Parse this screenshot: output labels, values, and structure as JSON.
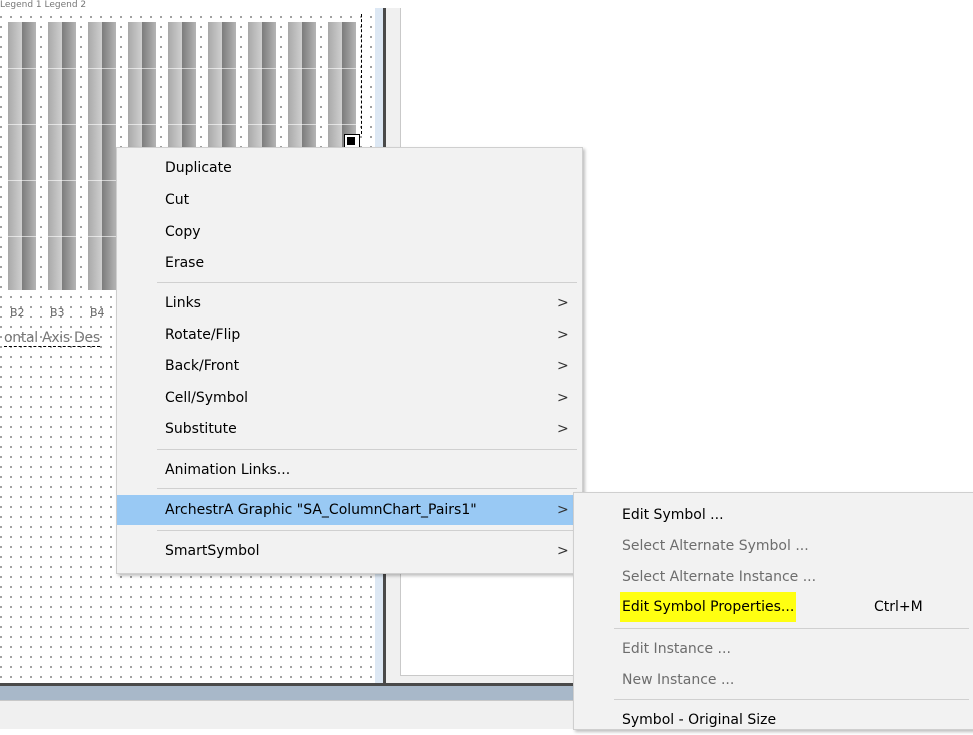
{
  "chart": {
    "legend": "Legend 1  Legend 2",
    "x_labels": [
      "B2",
      "B3",
      "B4"
    ],
    "axis_description": "ontal Axis Des"
  },
  "chart_data": {
    "type": "bar",
    "categories": [
      "B2",
      "B3",
      "B4"
    ],
    "xlabel": "ontal Axis Des"
  },
  "context_menu": {
    "items": [
      {
        "label": "Duplicate"
      },
      {
        "label": "Cut"
      },
      {
        "label": "Copy"
      },
      {
        "label": "Erase"
      },
      {
        "label": "Links",
        "submenu": true
      },
      {
        "label": "Rotate/Flip",
        "submenu": true
      },
      {
        "label": "Back/Front",
        "submenu": true
      },
      {
        "label": "Cell/Symbol",
        "submenu": true
      },
      {
        "label": "Substitute",
        "submenu": true
      },
      {
        "label": "Animation Links..."
      },
      {
        "label": "ArchestrA Graphic \"SA_ColumnChart_Pairs1\"",
        "submenu": true,
        "highlighted": true
      },
      {
        "label": "SmartSymbol",
        "submenu": true
      }
    ],
    "arrow_glyph": ">"
  },
  "submenu": {
    "items": [
      {
        "label": "Edit Symbol ...",
        "enabled": true
      },
      {
        "label": "Select Alternate Symbol ...",
        "enabled": false
      },
      {
        "label": "Select Alternate Instance ...",
        "enabled": false
      },
      {
        "label": "Edit Symbol Properties...",
        "enabled": true,
        "highlighted": true,
        "shortcut": "Ctrl+M"
      },
      {
        "label": "Edit Instance ...",
        "enabled": false
      },
      {
        "label": "New Instance ...",
        "enabled": false
      },
      {
        "label": "Symbol - Original Size",
        "enabled": true
      }
    ],
    "highlight_color": "#ffff11"
  }
}
